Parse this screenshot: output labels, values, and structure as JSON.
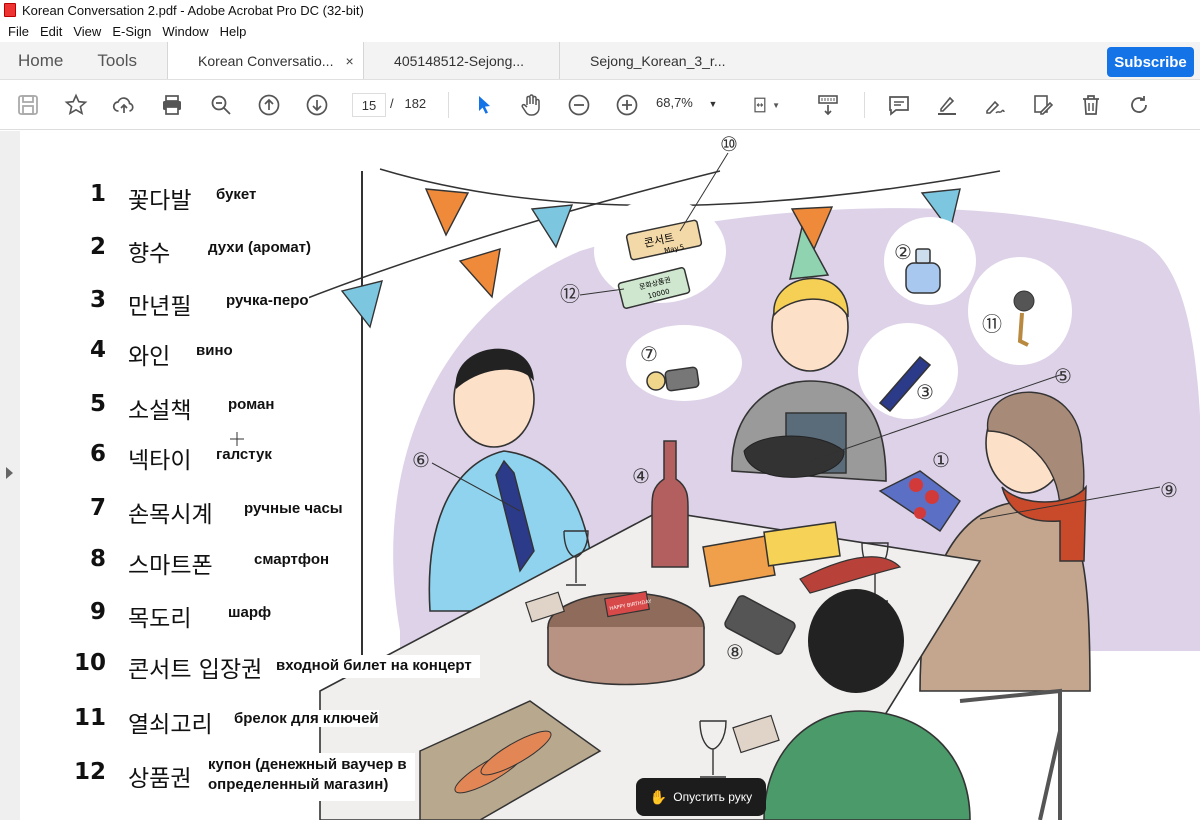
{
  "window": {
    "title": "Korean Conversation 2.pdf - Adobe Acrobat Pro DC (32-bit)"
  },
  "menu": [
    "File",
    "Edit",
    "View",
    "E-Sign",
    "Window",
    "Help"
  ],
  "nav": {
    "home": "Home",
    "tools": "Tools"
  },
  "tabs": [
    {
      "label": "Korean Conversatio...",
      "close": "×"
    },
    {
      "label": "405148512-Sejong..."
    },
    {
      "label": "Sejong_Korean_3_r..."
    }
  ],
  "subscribe_label": "Subscribe",
  "toolbar": {
    "page_current": "15",
    "page_sep": "/",
    "page_total": "182",
    "zoom": "68,7%",
    "icons": [
      "save-icon",
      "bookmark-star-icon",
      "upload-cloud-icon",
      "print-icon",
      "zoom-search-icon",
      "page-up-icon",
      "page-down-icon",
      "select-cursor-icon",
      "hand-icon",
      "zoom-out-icon",
      "zoom-in-icon",
      "page-fit-icon",
      "scroll-mode-icon",
      "comment-icon",
      "highlight-icon",
      "sign-icon",
      "edit-pdf-icon",
      "delete-icon",
      "rotate-icon"
    ]
  },
  "vocab": [
    {
      "num": "1",
      "kr": "꽃다발",
      "ru": "букет"
    },
    {
      "num": "2",
      "kr": "향수",
      "ru": "духи (аромат)"
    },
    {
      "num": "3",
      "kr": "만년필",
      "ru": "ручка-перо"
    },
    {
      "num": "4",
      "kr": "와인",
      "ru": "вино"
    },
    {
      "num": "5",
      "kr": "소설책",
      "ru": "роман"
    },
    {
      "num": "6",
      "kr": "넥타이",
      "ru": "галстук"
    },
    {
      "num": "7",
      "kr": "손목시계",
      "ru": "ручные часы"
    },
    {
      "num": "8",
      "kr": "스마트폰",
      "ru": "смартфон"
    },
    {
      "num": "9",
      "kr": "목도리",
      "ru": "шарф"
    },
    {
      "num": "10",
      "kr": "콘서트 입장권",
      "ru": "входной билет на концерт"
    },
    {
      "num": "11",
      "kr": "열쇠고리",
      "ru": "брелок для ключей"
    },
    {
      "num": "12",
      "kr": "상품권",
      "ru": "купон (денежный ваучер в",
      "ru2": "определенный магазин)"
    }
  ],
  "illustration": {
    "markers": [
      "①",
      "②",
      "③",
      "④",
      "⑤",
      "⑥",
      "⑦",
      "⑧",
      "⑨",
      "⑩",
      "⑪",
      "⑫"
    ],
    "ticket_text": "콘서트",
    "ticket_date": "May.5",
    "voucher_text": "문화상품권",
    "voucher_value": "10000",
    "cake_text": "HAPPY BIRTHDAY"
  },
  "raise_hand": {
    "label": "Опустить руку",
    "icon": "hand-icon"
  },
  "colors": {
    "accent": "#1473e6",
    "bg_purple": "#ddd2e8",
    "flag_orange": "#ee8a3a",
    "flag_blue": "#7cc6e0"
  }
}
